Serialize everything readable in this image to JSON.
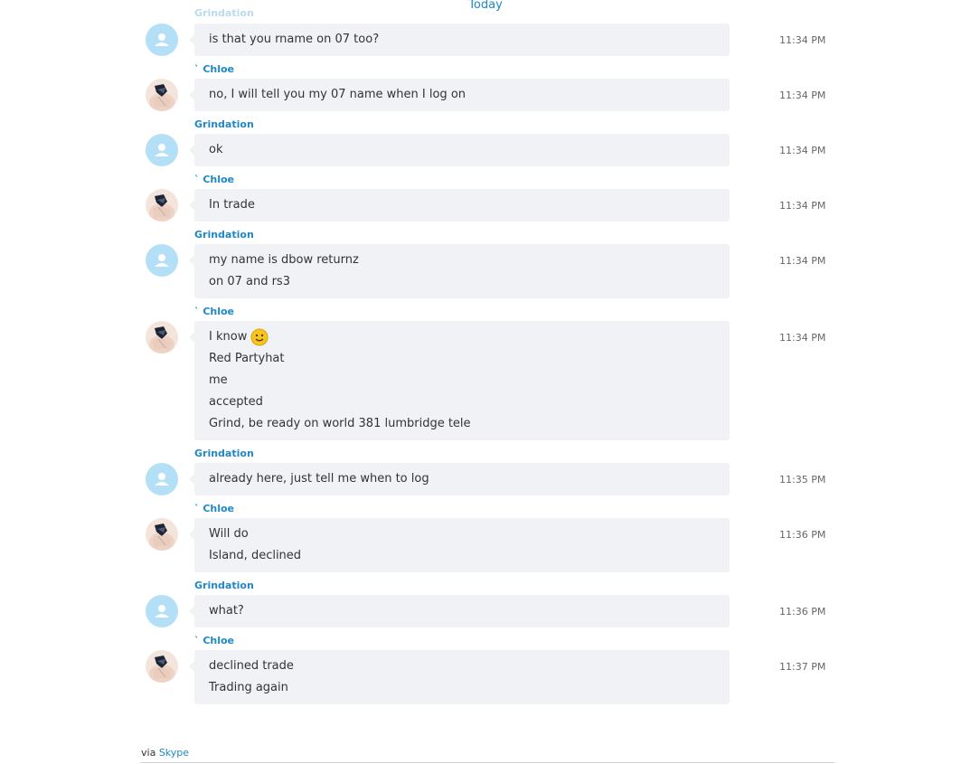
{
  "date_separator": "Today",
  "ghost_sender": "Grindation",
  "messages": [
    {
      "sender": "Grindation",
      "avatar": "default",
      "time": "11:34 PM",
      "lines": [
        "is that you rname on 07 too?"
      ]
    },
    {
      "sender": "` Chloe",
      "avatar": "photo",
      "time": "11:34 PM",
      "lines": [
        "no, I will tell you my 07 name when I log on"
      ]
    },
    {
      "sender": "Grindation",
      "avatar": "default",
      "time": "11:34 PM",
      "lines": [
        "ok"
      ]
    },
    {
      "sender": "` Chloe",
      "avatar": "photo",
      "time": "11:34 PM",
      "lines": [
        "In trade"
      ]
    },
    {
      "sender": "Grindation",
      "avatar": "default",
      "time": "11:34 PM",
      "lines": [
        "my name is dbow returnz",
        "on 07 and rs3"
      ]
    },
    {
      "sender": "` Chloe",
      "avatar": "photo",
      "time": "11:34 PM",
      "lines": [
        "I know",
        "Red Partyhat",
        "me",
        "accepted",
        "Grind, be ready on world 381 lumbridge tele"
      ],
      "emoji_after_line": 0,
      "emoji": "smile-emoticon"
    },
    {
      "sender": "Grindation",
      "avatar": "default",
      "time": "11:35 PM",
      "lines": [
        "already here, just tell me when to log"
      ]
    },
    {
      "sender": "` Chloe",
      "avatar": "photo",
      "time": "11:36 PM",
      "lines": [
        "Will do",
        "Island, declined"
      ]
    },
    {
      "sender": "Grindation",
      "avatar": "default",
      "time": "11:36 PM",
      "lines": [
        "what?"
      ]
    },
    {
      "sender": "` Chloe",
      "avatar": "photo",
      "time": "11:37 PM",
      "lines": [
        "declined trade",
        "Trading again"
      ]
    }
  ],
  "footer": {
    "prefix": "via ",
    "link": "Skype"
  },
  "colors": {
    "accent": "#1e88c7",
    "bubble": "#f0f2f6",
    "default_avatar": "#b3e0f7"
  }
}
